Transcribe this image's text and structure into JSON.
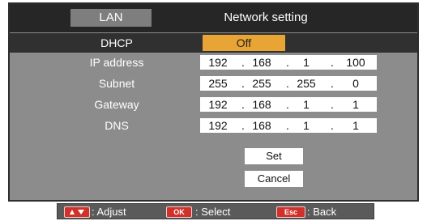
{
  "header": {
    "tab": "LAN",
    "title": "Network setting"
  },
  "rows": [
    {
      "label": "DHCP",
      "value": "Off"
    },
    {
      "label": "IP address",
      "octets": [
        "192",
        "168",
        "1",
        "100"
      ]
    },
    {
      "label": "Subnet",
      "octets": [
        "255",
        "255",
        "255",
        "0"
      ]
    },
    {
      "label": "Gateway",
      "octets": [
        "192",
        "168",
        "1",
        "1"
      ]
    },
    {
      "label": "DNS",
      "octets": [
        "192",
        "168",
        "1",
        "1"
      ]
    }
  ],
  "separator": ".",
  "buttons": {
    "set": "Set",
    "cancel": "Cancel"
  },
  "footer": {
    "adjust": ": Adjust",
    "ok_key": "OK",
    "select": ": Select",
    "esc_key": "Esc",
    "back": ": Back"
  },
  "colors": {
    "panel": "#8c8c8c",
    "header": "#262626",
    "selected_row": "#303030",
    "dhcp_button": "#e8a434",
    "key": "#d0322b"
  }
}
